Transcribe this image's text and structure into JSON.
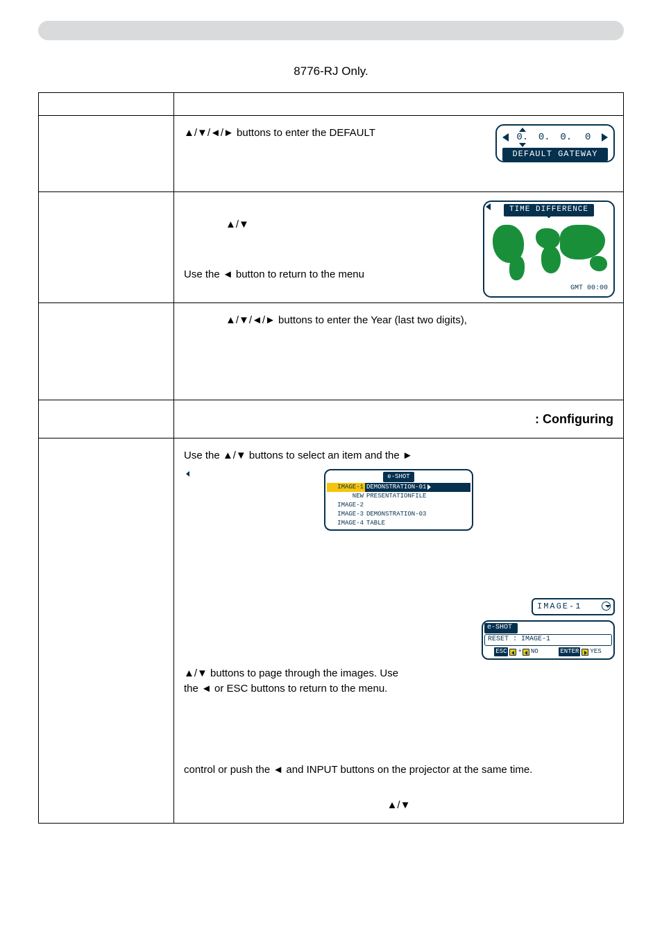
{
  "title_line": "8776-RJ Only.",
  "rows": {
    "header": {
      "left": "",
      "right": ""
    },
    "default_gateway": {
      "left": "",
      "text_before": "",
      "text_mid": "▲/▼/◄/► buttons to enter the DEFAULT",
      "text_after": "",
      "widget": {
        "cells": [
          "0.",
          "0.",
          "0.",
          "0"
        ],
        "label": "DEFAULT GATEWAY"
      }
    },
    "time_diff": {
      "left": "",
      "line1": "▲/▼",
      "line2": "Use the ◄ button to return to the menu",
      "widget": {
        "title": "TIME DIFFERENCE",
        "gmt": "GMT 00:00"
      }
    },
    "date": {
      "left": "",
      "text": "▲/▼/◄/► buttons to enter the Year (last two digits),"
    },
    "configuring": {
      "left": "",
      "text": ": Configuring"
    },
    "eshot": {
      "left": "",
      "line_top": "Use the ▲/▼ buttons to select an item and the ►",
      "menu": {
        "title": "e-SHOT",
        "items": [
          {
            "left": "IMAGE-1",
            "right": "DEMONSTRATION-01",
            "selected": true
          },
          {
            "left": "NEW IMAGE-2",
            "right": "PRESENTATIONFILE",
            "selected": false
          },
          {
            "left": "IMAGE-3",
            "right": "DEMONSTRATION-03",
            "selected": false
          },
          {
            "left": "IMAGE-4",
            "right": "TABLE",
            "selected": false
          }
        ]
      },
      "line_mid_a": "▲/▼ buttons to page through the images. Use",
      "line_mid_b": "the ◄ or ESC buttons to return to the menu.",
      "img_badge": "IMAGE-1",
      "reset_dialog": {
        "title": "e-SHOT",
        "body": "RESET : IMAGE-1",
        "esc": "ESC",
        "no_sym": "◄",
        "no": "NO",
        "enter": "ENTER",
        "yes_sym": "►",
        "yes": "YES"
      },
      "line_bot": "control or push the ◄ and INPUT buttons on the projector at the same time.",
      "line_last": "▲/▼"
    }
  }
}
